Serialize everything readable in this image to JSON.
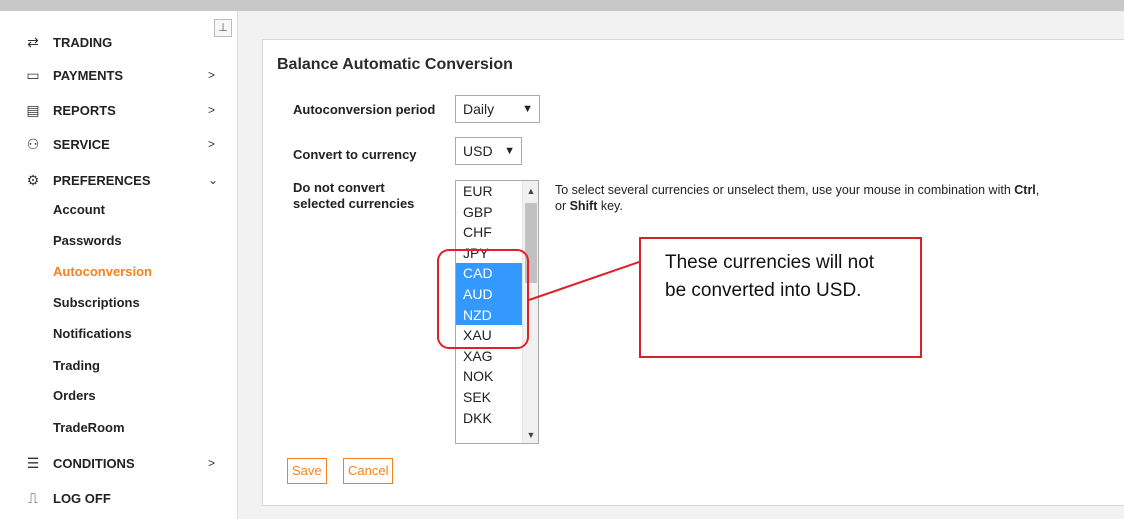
{
  "sidebar": {
    "pin_icon": "pin-icon",
    "items": [
      {
        "label": "TRADING",
        "icon": "swap-arrows-icon",
        "chevron": ""
      },
      {
        "label": "PAYMENTS",
        "icon": "wallet-icon",
        "chevron": ">"
      },
      {
        "label": "REPORTS",
        "icon": "document-icon",
        "chevron": ">"
      },
      {
        "label": "SERVICE",
        "icon": "service-icon",
        "chevron": ">"
      },
      {
        "label": "PREFERENCES",
        "icon": "gear-icon",
        "chevron": "⌄"
      },
      {
        "label": "CONDITIONS",
        "icon": "list-icon",
        "chevron": ">"
      },
      {
        "label": "LOG OFF",
        "icon": "exit-door-icon",
        "chevron": ""
      }
    ],
    "subitems": [
      "Account",
      "Passwords",
      "Autoconversion",
      "Subscriptions",
      "Notifications",
      "Trading",
      "Orders",
      "TradeRoom"
    ],
    "active_subitem": "Autoconversion"
  },
  "main": {
    "title": "Balance Automatic Conversion",
    "period_label": "Autoconversion period",
    "period_value": "Daily",
    "currency_label": "Convert to currency",
    "currency_value": "USD",
    "exclude_label_line1": "Do not convert",
    "exclude_label_line2": "selected currencies",
    "currencies": [
      "EUR",
      "GBP",
      "CHF",
      "JPY",
      "CAD",
      "AUD",
      "NZD",
      "XAU",
      "XAG",
      "NOK",
      "SEK",
      "DKK"
    ],
    "selected_currencies": [
      "CAD",
      "AUD",
      "NZD"
    ],
    "hint_part1": "To select several currencies or unselect them, use your mouse in combination with ",
    "hint_ctrl": "Ctrl",
    "hint_part2": ",",
    "hint_part3": "or ",
    "hint_shift": "Shift",
    "hint_part4": " key.",
    "save_label": "Save",
    "cancel_label": "Cancel"
  },
  "annotation": {
    "text": "These currencies will not be converted into USD.",
    "color": "#d6202a"
  },
  "colors": {
    "accent": "#f5821f",
    "selection": "#3399ff"
  }
}
